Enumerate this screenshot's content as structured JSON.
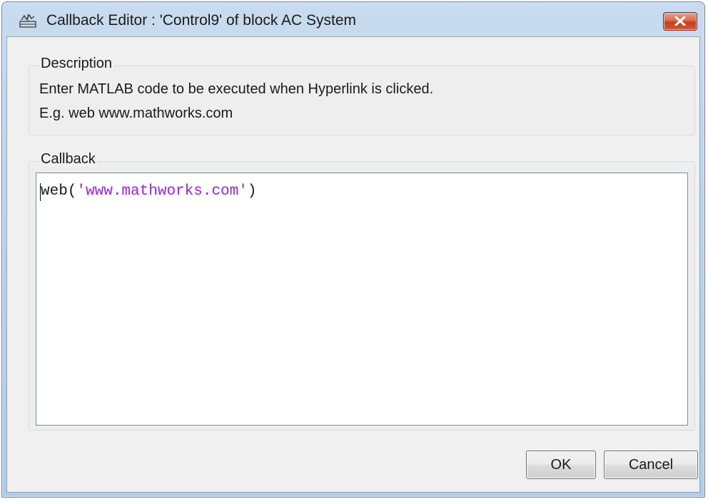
{
  "window": {
    "title": "Callback Editor : 'Control9' of block AC System",
    "app_icon": "simulink-block-icon",
    "close_icon": "close-icon"
  },
  "description": {
    "group_label": "Description",
    "line1": "Enter MATLAB code to be executed when Hyperlink is clicked.",
    "line2": "E.g. web www.mathworks.com"
  },
  "callback": {
    "group_label": "Callback",
    "code_prefix": "web(",
    "code_string": "'www.mathworks.com'",
    "code_suffix": ")",
    "string_color": "#a020f0"
  },
  "buttons": {
    "ok_label": "OK",
    "cancel_label": "Cancel"
  }
}
